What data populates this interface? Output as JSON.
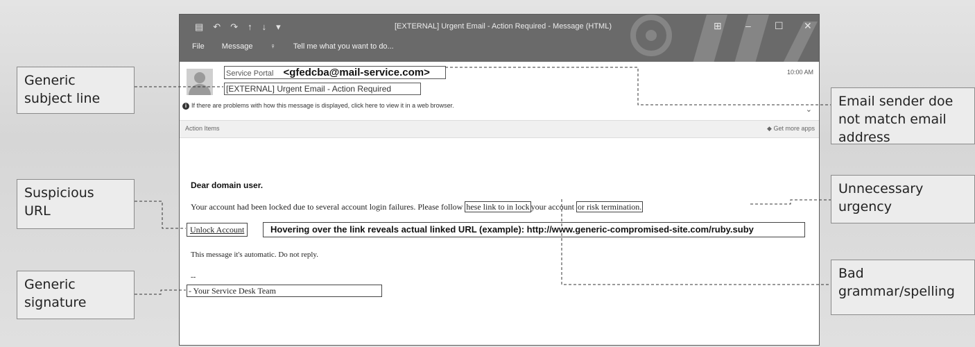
{
  "window": {
    "title": "[EXTERNAL]  Urgent Email - Action Required - Message (HTML)",
    "quick_access_icons": [
      "save-icon",
      "undo-icon",
      "redo-icon",
      "up-arrow-icon",
      "down-arrow-icon",
      "dropdown-icon"
    ],
    "menu": {
      "file": "File",
      "message": "Message",
      "tell_me": "Tell me what you want to do..."
    },
    "controls": {
      "restore": "⊞",
      "minimize": "–",
      "maximize": "☐",
      "close": "✕"
    }
  },
  "email": {
    "sender_name": "Service Portal",
    "sender_address": "<gfedcba@mail-service.com>",
    "subject": "[EXTERNAL]  Urgent Email - Action Required",
    "time": "10:00 AM",
    "info_bar": "If there are problems with how this message is displayed, click here to view it in a web browser.",
    "action_items": "Action Items",
    "get_more_apps": "Get more apps",
    "greeting": "Dear domain user.",
    "body_part1": "Your account had been locked due to several account login failures. Please follow ",
    "body_link": "hese link to in lock",
    "body_part2": "your account ",
    "body_threat": "or risk termination.",
    "unlock_link": "Unlock Account",
    "hover_text": "Hovering over the link reveals actual linked URL (example): http://www.generic-compromised-site.com/ruby.suby",
    "auto_msg": "This message it's automatic. Do not reply.",
    "dashes": "--",
    "signature": "- Your Service Desk Team"
  },
  "callouts": {
    "subject_line": {
      "line1": "Generic",
      "line2": "subject line"
    },
    "suspicious_url": {
      "line1": "Suspicious",
      "line2": "URL"
    },
    "signature": {
      "line1": "Generic",
      "line2": "signature"
    },
    "sender": {
      "line1": "Email sender doe",
      "line2": "not match email",
      "line3": "address"
    },
    "urgency": {
      "line1": "Unnecessary",
      "line2": "urgency"
    },
    "grammar": {
      "line1": "Bad",
      "line2": "grammar/spelling"
    }
  }
}
